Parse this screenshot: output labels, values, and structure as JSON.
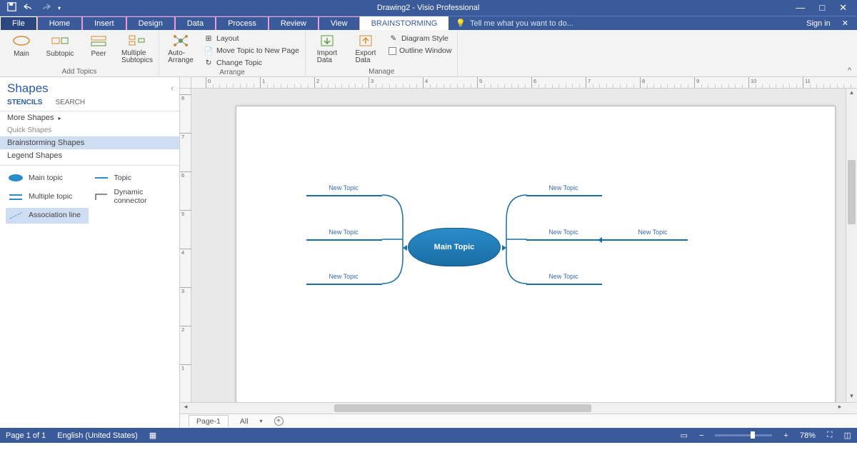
{
  "title": "Drawing2 - Visio Professional",
  "tabs": {
    "file": "File",
    "home": "Home",
    "insert": "Insert",
    "design": "Design",
    "data": "Data",
    "process": "Process",
    "review": "Review",
    "view": "View",
    "brain": "BRAINSTORMING"
  },
  "tell_me": "Tell me what you want to do...",
  "signin": "Sign in",
  "ribbon": {
    "addtopics_label": "Add Topics",
    "main": "Main",
    "subtopic": "Subtopic",
    "peer": "Peer",
    "multiple": "Multiple\nSubtopics",
    "arrange_label": "Arrange",
    "autoarrange": "Auto-\nArrange",
    "layout": "Layout",
    "movetopic": "Move Topic to New Page",
    "changetopic": "Change Topic",
    "import": "Import\nData",
    "export": "Export\nData",
    "manage_label": "Manage",
    "diagstyle": "Diagram Style",
    "outlinewin": "Outline Window"
  },
  "shapes": {
    "title": "Shapes",
    "stencils": "STENCILS",
    "search": "SEARCH",
    "more": "More Shapes",
    "quick": "Quick Shapes",
    "brain": "Brainstorming Shapes",
    "legend": "Legend Shapes",
    "items": {
      "maintopic": "Main topic",
      "topic": "Topic",
      "multi": "Multiple topic",
      "dyn": "Dynamic connector",
      "assoc": "Association line"
    }
  },
  "diagram": {
    "main": "Main Topic",
    "topic": "New Topic"
  },
  "pagetabs": {
    "page1": "Page-1",
    "all": "All"
  },
  "status": {
    "page": "Page 1 of 1",
    "lang": "English (United States)",
    "zoom": "78%"
  }
}
